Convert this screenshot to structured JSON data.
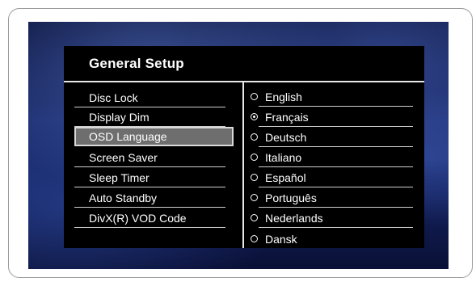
{
  "title": "General Setup",
  "menu": [
    {
      "label": "Disc Lock",
      "selected": false
    },
    {
      "label": "Display Dim",
      "selected": false
    },
    {
      "label": "OSD Language",
      "selected": true
    },
    {
      "label": "Screen Saver",
      "selected": false
    },
    {
      "label": "Sleep Timer",
      "selected": false
    },
    {
      "label": "Auto Standby",
      "selected": false
    },
    {
      "label": "DivX(R) VOD Code",
      "selected": false
    }
  ],
  "languages": [
    {
      "label": "English",
      "checked": false
    },
    {
      "label": "Français",
      "checked": true
    },
    {
      "label": "Deutsch",
      "checked": false
    },
    {
      "label": "Italiano",
      "checked": false
    },
    {
      "label": "Español",
      "checked": false
    },
    {
      "label": "Português",
      "checked": false
    },
    {
      "label": "Nederlands",
      "checked": false
    },
    {
      "label": "Dansk",
      "checked": false
    }
  ],
  "colors": {
    "panel": "#000000",
    "highlight": "#6e6e6e",
    "text": "#ffffff",
    "background": "#1a2a6a"
  }
}
